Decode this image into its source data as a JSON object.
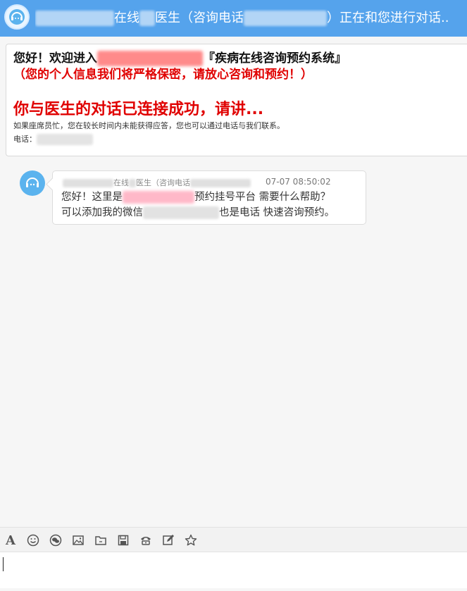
{
  "header": {
    "title_part1": "在线",
    "title_part2": "医生（咨询电话",
    "title_part3": "）正在和您进行对话.."
  },
  "welcome": {
    "greeting_prefix": "您好！欢迎进入",
    "system_name": "『疾病在线咨询预约系统』",
    "privacy_note": "（您的个人信息我们将严格保密，请放心咨询和预约！）",
    "connected": "你与医生的对话已连接成功，请讲...",
    "busy_note": "如果座席员忙，您在较长时间内未能获得应答，您也可以通过电话与我们联系。",
    "phone_label": "电话："
  },
  "message": {
    "sender_part1": "在线",
    "sender_part2": "医生（咨询电话",
    "time": "07-07 08:50:02",
    "line1_prefix": "您好！这里是",
    "line1_suffix": "预约挂号平台 需要什么帮助？",
    "line2_prefix": "可以添加我的微信",
    "line2_suffix": "也是电话 快速咨询预约。"
  },
  "toolbar": {
    "items": [
      "font-icon",
      "emoji-icon",
      "wechat-icon",
      "image-icon",
      "folder-icon",
      "save-icon",
      "phone-icon",
      "edit-icon",
      "star-icon"
    ]
  },
  "input": {
    "value": ""
  }
}
